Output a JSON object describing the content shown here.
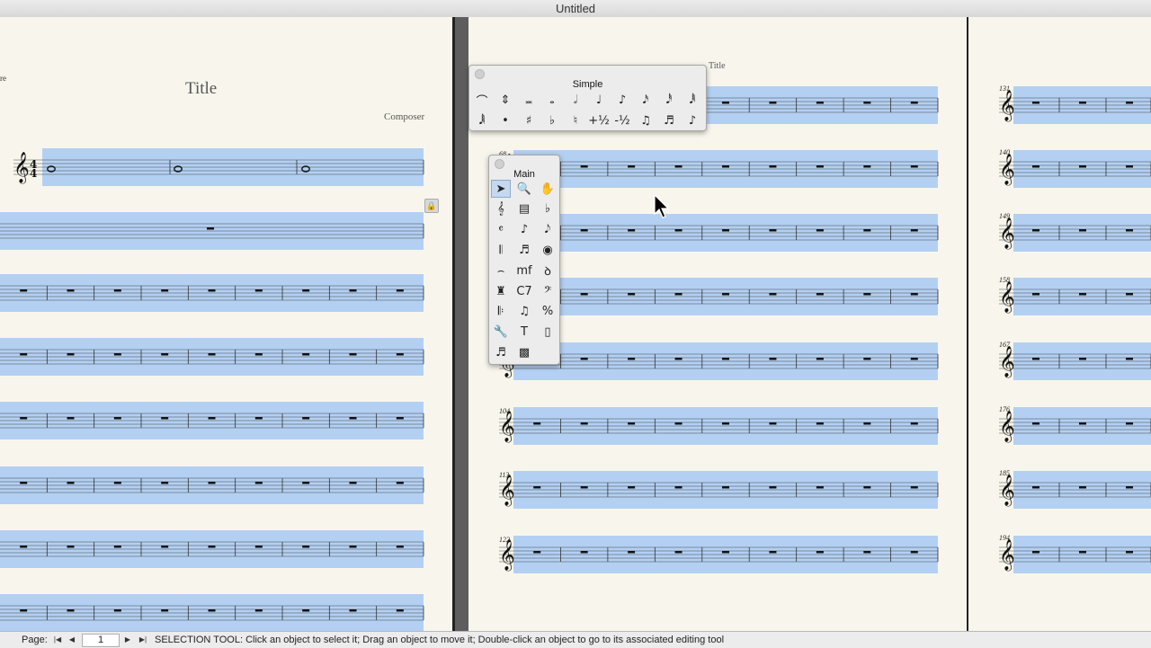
{
  "window": {
    "title": "Untitled"
  },
  "score": {
    "title": "Title",
    "composer": "Composer",
    "header_title_right": "Title",
    "partial_label_left": "re",
    "measure_numbers_middle": [
      "68",
      "104",
      "113",
      "122"
    ],
    "measure_numbers_right": [
      "131",
      "140",
      "149",
      "158",
      "167",
      "176",
      "185",
      "194"
    ]
  },
  "palettes": {
    "simple": {
      "title": "Simple",
      "row1": [
        {
          "icon": "tie-icon",
          "glyph": "⌒"
        },
        {
          "icon": "flip-stem-icon",
          "glyph": "⇕"
        },
        {
          "icon": "double-whole-note-icon",
          "glyph": "𝅜"
        },
        {
          "icon": "whole-note-icon",
          "glyph": "𝅝"
        },
        {
          "icon": "half-note-icon",
          "glyph": "𝅗𝅥"
        },
        {
          "icon": "quarter-note-icon",
          "glyph": "♩"
        },
        {
          "icon": "eighth-note-icon",
          "glyph": "♪"
        },
        {
          "icon": "sixteenth-note-icon",
          "glyph": "𝅘𝅥𝅯"
        },
        {
          "icon": "thirty-second-note-icon",
          "glyph": "𝅘𝅥𝅰"
        },
        {
          "icon": "sixty-fourth-note-icon",
          "glyph": "𝅘𝅥𝅱"
        }
      ],
      "row2": [
        {
          "icon": "one-twenty-eighth-note-icon",
          "glyph": "𝅘𝅥𝅲"
        },
        {
          "icon": "dot-icon",
          "glyph": "•"
        },
        {
          "icon": "sharp-icon",
          "glyph": "♯"
        },
        {
          "icon": "flat-icon",
          "glyph": "♭"
        },
        {
          "icon": "natural-icon",
          "glyph": "♮"
        },
        {
          "icon": "half-step-up-icon",
          "glyph": "+½"
        },
        {
          "icon": "half-step-down-icon",
          "glyph": "-½"
        },
        {
          "icon": "tuplet-icon",
          "glyph": "♫"
        },
        {
          "icon": "tuplet-group-icon",
          "glyph": "♬"
        },
        {
          "icon": "grace-note-icon",
          "glyph": "♪"
        }
      ]
    },
    "main": {
      "title": "Main",
      "tools": [
        {
          "icon": "selection-arrow-icon",
          "glyph": "➤",
          "selected": true
        },
        {
          "icon": "zoom-icon",
          "glyph": "🔍"
        },
        {
          "icon": "hand-grabber-icon",
          "glyph": "✋"
        },
        {
          "icon": "staff-icon",
          "glyph": "𝄞"
        },
        {
          "icon": "measure-icon",
          "glyph": "▤"
        },
        {
          "icon": "key-signature-icon",
          "glyph": "♭"
        },
        {
          "icon": "time-signature-icon",
          "glyph": "𝄴"
        },
        {
          "icon": "simple-entry-icon",
          "glyph": "♪"
        },
        {
          "icon": "speedy-entry-icon",
          "glyph": "𝅘𝅥𝅮"
        },
        {
          "icon": "hyperscribe-icon",
          "glyph": "𝄃"
        },
        {
          "icon": "tuplet-tool-icon",
          "glyph": "♬"
        },
        {
          "icon": "smart-shape-icon",
          "glyph": "◉"
        },
        {
          "icon": "articulation-icon",
          "glyph": "⌢"
        },
        {
          "icon": "expression-icon",
          "glyph": "mf"
        },
        {
          "icon": "repeat-icon",
          "glyph": "ꝺ"
        },
        {
          "icon": "lyrics-icon",
          "glyph": "♜"
        },
        {
          "icon": "chord-icon",
          "glyph": "C7"
        },
        {
          "icon": "clef-icon",
          "glyph": "𝄢"
        },
        {
          "icon": "mirror-icon",
          "glyph": "𝄆"
        },
        {
          "icon": "special-tools-icon",
          "glyph": "♫"
        },
        {
          "icon": "percent-icon",
          "glyph": "%"
        },
        {
          "icon": "wrench-icon",
          "glyph": "🔧"
        },
        {
          "icon": "text-tool-icon",
          "glyph": "T"
        },
        {
          "icon": "page-layout-icon",
          "glyph": "▯"
        },
        {
          "icon": "note-mover-icon",
          "glyph": "♬"
        },
        {
          "icon": "graphics-icon",
          "glyph": "▩"
        }
      ]
    }
  },
  "status": {
    "page_label": "Page:",
    "page_number": "1",
    "message": "SELECTION TOOL: Click an object to select it; Drag an object to move it; Double-click an object to go to its associated editing tool"
  },
  "colors": {
    "selection": "#b3d0f3",
    "paper": "#f8f6ec",
    "gutter": "#5e5e5e"
  }
}
